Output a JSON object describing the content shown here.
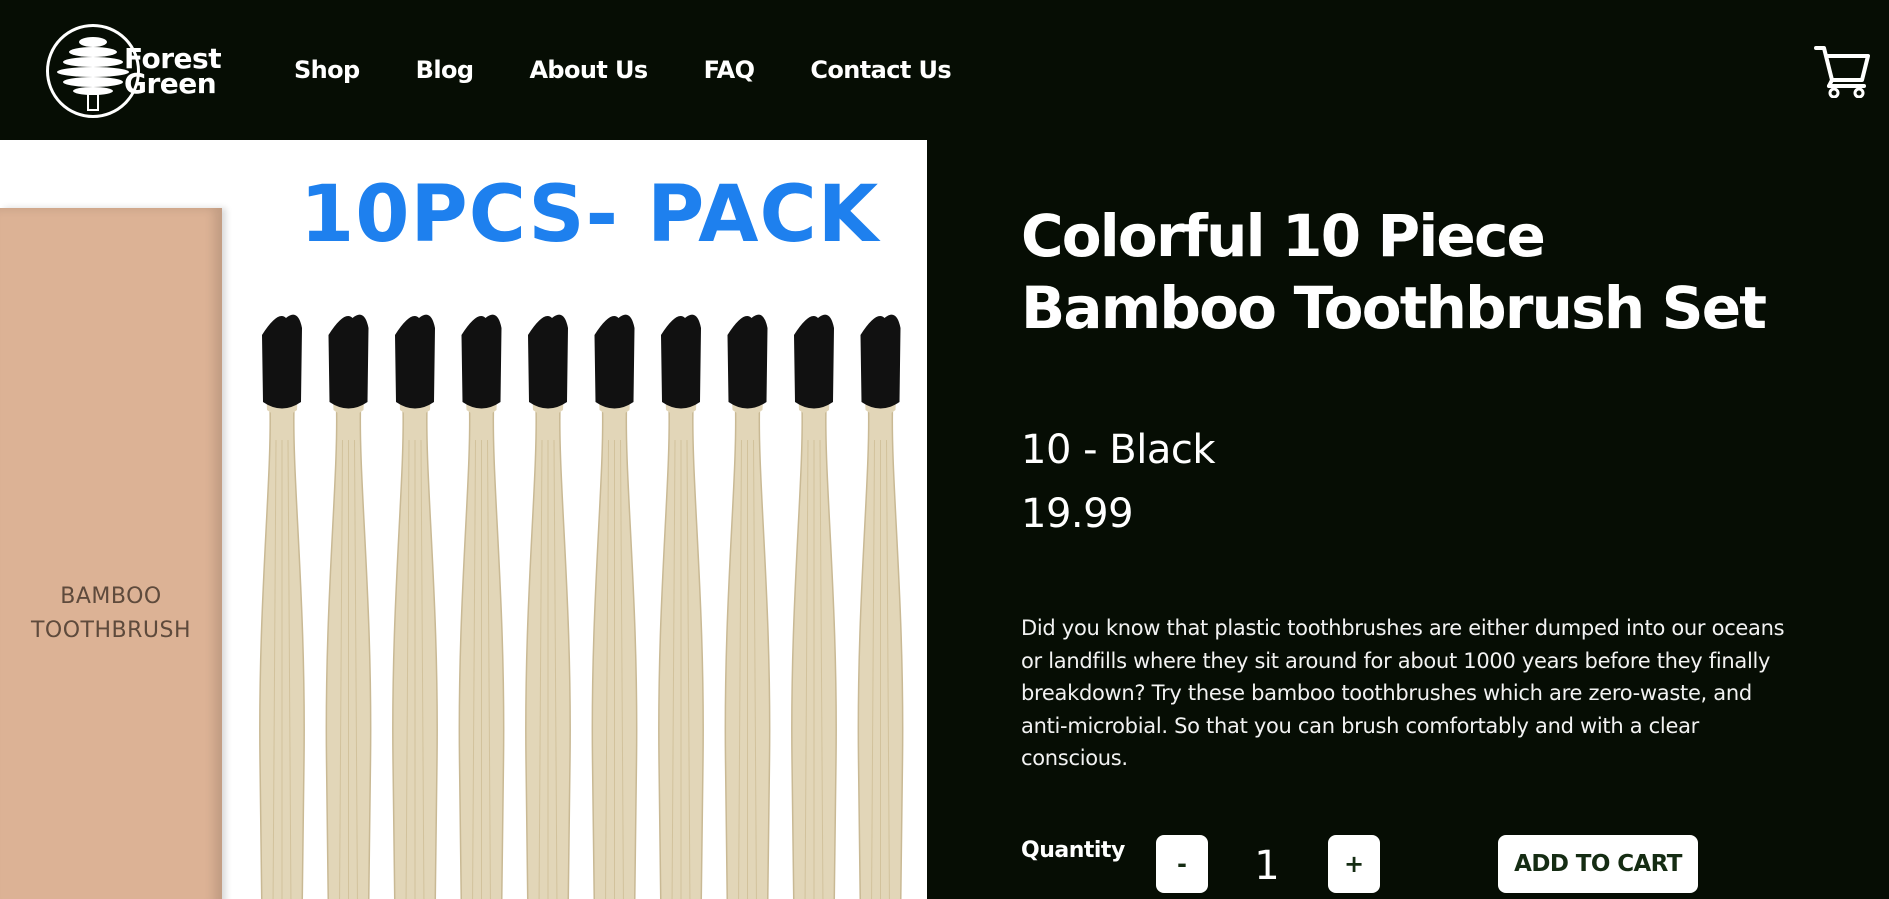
{
  "brand": {
    "name_line1": "Forest",
    "name_line2": "Green"
  },
  "nav": {
    "items": [
      {
        "label": "Shop"
      },
      {
        "label": "Blog"
      },
      {
        "label": "About Us"
      },
      {
        "label": "FAQ"
      },
      {
        "label": "Contact Us"
      }
    ]
  },
  "header": {
    "cart_icon": "shopping-cart-icon"
  },
  "product_image": {
    "banner_text": "10PCS- PACK",
    "box_label_line1": "BAMBOO",
    "box_label_line2": "TOOTHBRUSH",
    "brush_count": 10
  },
  "product": {
    "title_line1": "Colorful 10 Piece",
    "title_line2": "Bamboo Toothbrush Set",
    "variant": "10 - Black",
    "price": "19.99",
    "description": "Did you know that plastic toothbrushes are either dumped into our oceans or landfills where they sit around for about 1000 years before they finally breakdown? Try these bamboo toothbrushes which are zero-waste, and anti-microbial. So that you can brush comfortably and with a clear conscious."
  },
  "purchase": {
    "quantity_label": "Quantity",
    "minus_label": "-",
    "quantity_value": "1",
    "plus_label": "+",
    "add_to_cart_label": "ADD TO CART"
  },
  "colors": {
    "background": "#060d04",
    "button_bg": "#ffffff",
    "button_text": "#152c13",
    "banner_blue": "#1e80ee",
    "box_kraft": "#dcb295"
  }
}
